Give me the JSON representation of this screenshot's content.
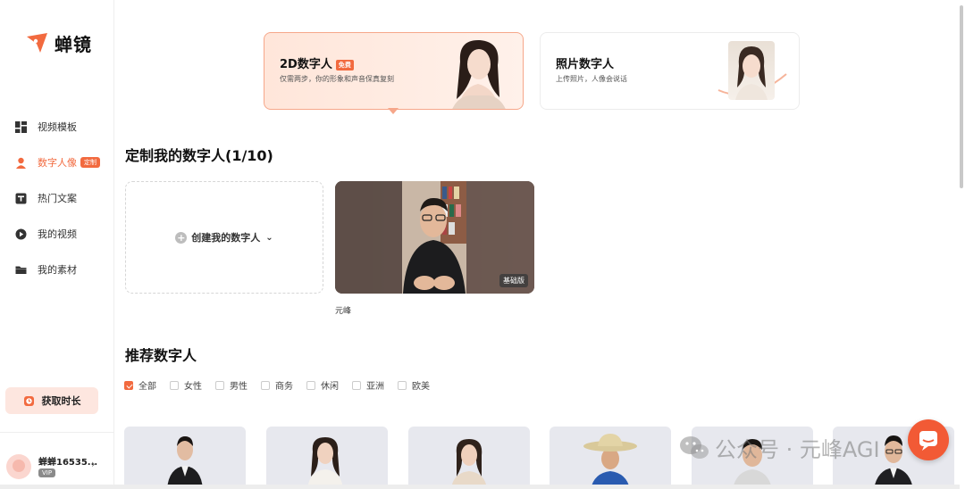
{
  "brand": {
    "name": "蝉镜",
    "color": "#f26a3f"
  },
  "sidebar": {
    "items": [
      {
        "label": "视频模板",
        "icon": "grid-icon",
        "active": false
      },
      {
        "label": "数字人像",
        "icon": "person-icon",
        "active": true,
        "tag": "定制"
      },
      {
        "label": "热门文案",
        "icon": "document-icon",
        "active": false
      },
      {
        "label": "我的视频",
        "icon": "play-icon",
        "active": false
      },
      {
        "label": "我的素材",
        "icon": "folder-icon",
        "active": false
      }
    ],
    "cta_label": "获取时长",
    "user": {
      "name": "蝉蝉16535...",
      "badge": "VIP"
    }
  },
  "type_cards": [
    {
      "title": "2D数字人",
      "badge": "免费",
      "subtitle": "仅需两步，你的形象和声音保真复刻",
      "selected": true
    },
    {
      "title": "照片数字人",
      "subtitle": "上传照片，人像会说话",
      "selected": false
    }
  ],
  "custom_section": {
    "title": "定制我的数字人(1/10)",
    "create_label": "创建我的数字人",
    "videos": [
      {
        "name": "元峰",
        "badge": "基础版"
      }
    ]
  },
  "recommend_section": {
    "title": "推荐数字人",
    "filters": [
      {
        "label": "全部",
        "checked": true
      },
      {
        "label": "女性",
        "checked": false
      },
      {
        "label": "男性",
        "checked": false
      },
      {
        "label": "商务",
        "checked": false
      },
      {
        "label": "休闲",
        "checked": false
      },
      {
        "label": "亚洲",
        "checked": false
      },
      {
        "label": "欧美",
        "checked": false
      }
    ]
  },
  "watermark": "公众号 · 元峰AGI"
}
